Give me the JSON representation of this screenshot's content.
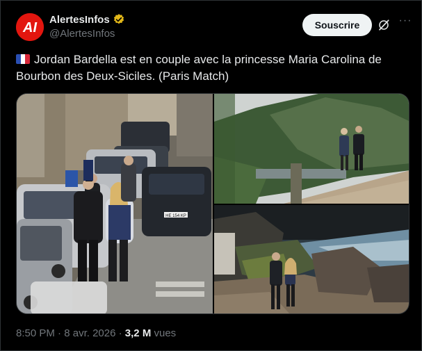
{
  "account": {
    "display_name": "AlertesInfos",
    "handle": "@AlertesInfos",
    "avatar_text": "AI"
  },
  "actions": {
    "subscribe_label": "Souscrire",
    "more_label": "···"
  },
  "tweet": {
    "text": "Jordan Bardella est en couple avec la princesse Maria Carolina de Bourbon des Deux-Siciles. (Paris Match)",
    "flag": "france-flag"
  },
  "media": {
    "plate_text": "HE 154 KP"
  },
  "meta": {
    "time": "8:50 PM",
    "separator": "·",
    "date": "8 avr. 2026",
    "views_count": "3,2 M",
    "views_label": "vues"
  },
  "colors": {
    "brand_red": "#e3160f",
    "verified_gold": "#e2b719",
    "text_primary": "#e7e9ea",
    "text_secondary": "#71767b",
    "background": "#000000"
  }
}
